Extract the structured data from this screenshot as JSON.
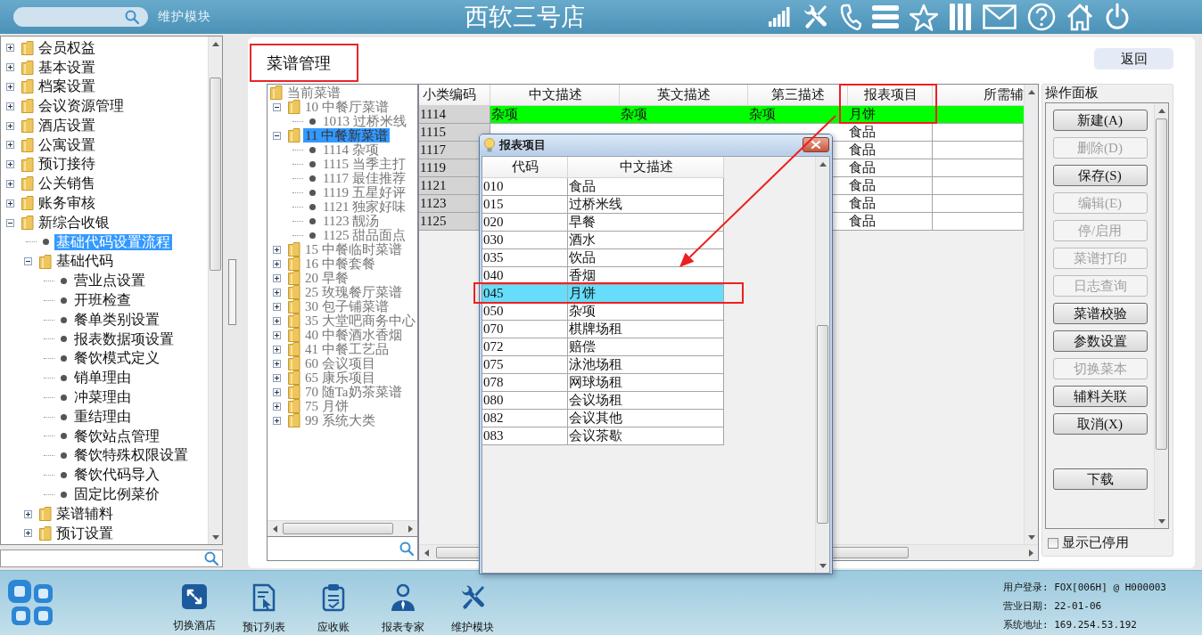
{
  "top_bar": {
    "module_label": "维护模块",
    "title": "西软三号店"
  },
  "nav_tree": {
    "items": [
      {
        "kind": "folder",
        "label": "会员权益",
        "expanded": false,
        "selected": false
      },
      {
        "kind": "folder",
        "label": "基本设置",
        "expanded": false,
        "selected": false
      },
      {
        "kind": "folder",
        "label": "档案设置",
        "expanded": false,
        "selected": false
      },
      {
        "kind": "folder",
        "label": "会议资源管理",
        "expanded": false,
        "selected": false
      },
      {
        "kind": "folder",
        "label": "酒店设置",
        "expanded": false,
        "selected": false
      },
      {
        "kind": "folder",
        "label": "公寓设置",
        "expanded": false,
        "selected": false
      },
      {
        "kind": "folder",
        "label": "预订接待",
        "expanded": false,
        "selected": false
      },
      {
        "kind": "folder",
        "label": "公关销售",
        "expanded": false,
        "selected": false
      },
      {
        "kind": "folder",
        "label": "账务审核",
        "expanded": false,
        "selected": false
      },
      {
        "kind": "folder",
        "label": "新综合收银",
        "expanded": true,
        "selected": false,
        "children": [
          {
            "kind": "leaf",
            "label": "基础代码设置流程",
            "selected": true
          },
          {
            "kind": "folder",
            "label": "基础代码",
            "expanded": true,
            "selected": false,
            "children": [
              {
                "kind": "leaf",
                "label": "营业点设置",
                "selected": false
              },
              {
                "kind": "leaf",
                "label": "开班检查",
                "selected": false
              },
              {
                "kind": "leaf",
                "label": "餐单类别设置",
                "selected": false
              },
              {
                "kind": "leaf",
                "label": "报表数据项设置",
                "selected": false
              },
              {
                "kind": "leaf",
                "label": "餐饮模式定义",
                "selected": false
              },
              {
                "kind": "leaf",
                "label": "销单理由",
                "selected": false
              },
              {
                "kind": "leaf",
                "label": "冲菜理由",
                "selected": false
              },
              {
                "kind": "leaf",
                "label": "重结理由",
                "selected": false
              },
              {
                "kind": "leaf",
                "label": "餐饮站点管理",
                "selected": false
              },
              {
                "kind": "leaf",
                "label": "餐饮特殊权限设置",
                "selected": false
              },
              {
                "kind": "leaf",
                "label": "餐饮代码导入",
                "selected": false
              },
              {
                "kind": "leaf",
                "label": "固定比例菜价",
                "selected": false
              }
            ]
          },
          {
            "kind": "folder",
            "label": "菜谱辅料",
            "expanded": false,
            "selected": false
          },
          {
            "kind": "folder",
            "label": "预订设置",
            "expanded": false,
            "selected": false
          }
        ]
      }
    ]
  },
  "page": {
    "title": "菜谱管理",
    "back_button": "返回"
  },
  "menu_tree": {
    "items": [
      {
        "kind": "root",
        "label": "当前菜谱",
        "selected": false,
        "children": [
          {
            "kind": "folder",
            "label": "10 中餐厅菜谱",
            "expanded": true,
            "selected": false,
            "children": [
              {
                "kind": "leaf",
                "label": "1013 过桥米线",
                "selected": false
              }
            ]
          },
          {
            "kind": "folder",
            "label": "11 中餐新菜谱",
            "expanded": true,
            "selected": true,
            "children": [
              {
                "kind": "leaf",
                "label": "1114 杂项",
                "selected": false
              },
              {
                "kind": "leaf",
                "label": "1115 当季主打",
                "selected": false
              },
              {
                "kind": "leaf",
                "label": "1117 最佳推荐",
                "selected": false
              },
              {
                "kind": "leaf",
                "label": "1119 五星好评",
                "selected": false
              },
              {
                "kind": "leaf",
                "label": "1121 独家好味",
                "selected": false
              },
              {
                "kind": "leaf",
                "label": "1123 靓汤",
                "selected": false
              },
              {
                "kind": "leaf",
                "label": "1125 甜品面点",
                "selected": false
              }
            ]
          },
          {
            "kind": "folder",
            "label": "15 中餐临时菜谱",
            "expanded": false,
            "selected": false
          },
          {
            "kind": "folder",
            "label": "16 中餐套餐",
            "expanded": false,
            "selected": false
          },
          {
            "kind": "folder",
            "label": "20 早餐",
            "expanded": false,
            "selected": false
          },
          {
            "kind": "folder",
            "label": "25 玫瑰餐厅菜谱",
            "expanded": false,
            "selected": false
          },
          {
            "kind": "folder",
            "label": "30 包子铺菜谱",
            "expanded": false,
            "selected": false
          },
          {
            "kind": "folder",
            "label": "35 大堂吧商务中心",
            "expanded": false,
            "selected": false
          },
          {
            "kind": "folder",
            "label": "40 中餐酒水香烟",
            "expanded": false,
            "selected": false
          },
          {
            "kind": "folder",
            "label": "41 中餐工艺品",
            "expanded": false,
            "selected": false
          },
          {
            "kind": "folder",
            "label": "60 会议项目",
            "expanded": false,
            "selected": false
          },
          {
            "kind": "folder",
            "label": "65 康乐项目",
            "expanded": false,
            "selected": false
          },
          {
            "kind": "folder",
            "label": "70 随Ta奶茶菜谱",
            "expanded": false,
            "selected": false
          },
          {
            "kind": "folder",
            "label": "75 月饼",
            "expanded": false,
            "selected": false
          },
          {
            "kind": "folder",
            "label": "99 系统大类",
            "expanded": false,
            "selected": false
          }
        ]
      }
    ]
  },
  "table": {
    "columns": [
      "小类编码",
      "中文描述",
      "英文描述",
      "第三描述",
      "报表项目",
      "所需辅"
    ],
    "rows": [
      {
        "code": "1114",
        "descriptions": [
          "杂项",
          "杂项",
          "杂项"
        ],
        "report_item": "月饼",
        "selected": true
      },
      {
        "code": "1115",
        "report_item": "食品",
        "selected": false
      },
      {
        "code": "1117",
        "report_item": "食品",
        "selected": false
      },
      {
        "code": "1119",
        "report_item": "食品",
        "selected": false
      },
      {
        "code": "1121",
        "report_item": "食品",
        "selected": false
      },
      {
        "code": "1123",
        "report_item": "食品",
        "selected": false
      },
      {
        "code": "1125",
        "report_item": "食品",
        "selected": false
      }
    ]
  },
  "dialog": {
    "title": "报表项目",
    "columns": [
      "代码",
      "中文描述"
    ],
    "rows": [
      {
        "code": "010",
        "name": "食品",
        "selected": false
      },
      {
        "code": "015",
        "name": "过桥米线",
        "selected": false
      },
      {
        "code": "020",
        "name": "早餐",
        "selected": false
      },
      {
        "code": "030",
        "name": "酒水",
        "selected": false
      },
      {
        "code": "035",
        "name": "饮品",
        "selected": false
      },
      {
        "code": "040",
        "name": "香烟",
        "selected": false
      },
      {
        "code": "045",
        "name": "月饼",
        "selected": true
      },
      {
        "code": "050",
        "name": "杂项",
        "selected": false
      },
      {
        "code": "070",
        "name": "棋牌场租",
        "selected": false
      },
      {
        "code": "072",
        "name": "赔偿",
        "selected": false
      },
      {
        "code": "075",
        "name": "泳池场租",
        "selected": false
      },
      {
        "code": "078",
        "name": "网球场租",
        "selected": false
      },
      {
        "code": "080",
        "name": "会议场租",
        "selected": false
      },
      {
        "code": "082",
        "name": "会议其他",
        "selected": false
      },
      {
        "code": "083",
        "name": "会议茶歇",
        "selected": false
      }
    ]
  },
  "panel": {
    "title": "操作面板",
    "buttons": [
      {
        "label": "新建(A)",
        "disabled": false
      },
      {
        "label": "删除(D)",
        "disabled": true
      },
      {
        "label": "保存(S)",
        "disabled": false
      },
      {
        "label": "编辑(E)",
        "disabled": true
      },
      {
        "label": "停/启用",
        "disabled": true
      },
      {
        "label": "菜谱打印",
        "disabled": true
      },
      {
        "label": "日志查询",
        "disabled": true
      },
      {
        "label": "菜谱校验",
        "disabled": false
      },
      {
        "label": "参数设置",
        "disabled": false
      },
      {
        "label": "切换菜本",
        "disabled": true
      },
      {
        "label": "辅料关联",
        "disabled": false
      },
      {
        "label": "取消(X)",
        "disabled": false
      }
    ],
    "lower_buttons": [
      {
        "label": "下载",
        "disabled": false
      }
    ],
    "show_disabled": {
      "label": "显示已停用",
      "checked": false
    }
  },
  "bottom_bar": {
    "shortcuts": [
      {
        "kind": "resize",
        "label": "切换酒店"
      },
      {
        "kind": "document",
        "label": "预订列表"
      },
      {
        "kind": "clipboard",
        "label": "应收账"
      },
      {
        "kind": "person",
        "label": "报表专家"
      },
      {
        "kind": "tools",
        "label": "维护模块"
      }
    ],
    "info": [
      "用户登录: FOX[006H] @ H000003",
      "营业日期: 22-01-06",
      "系统地址: 169.254.53.192"
    ]
  }
}
